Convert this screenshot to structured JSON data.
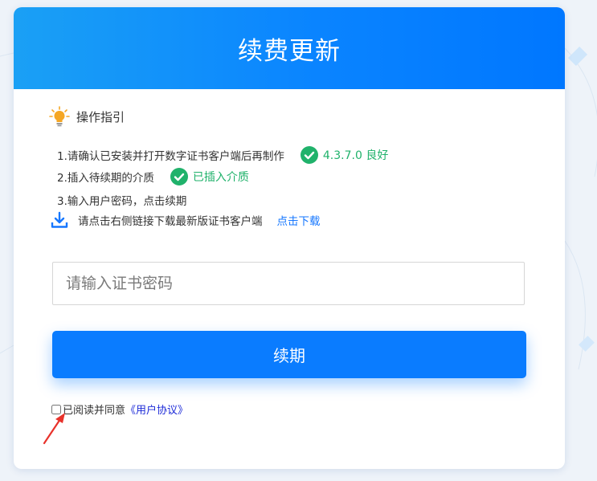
{
  "header": {
    "title": "续费更新"
  },
  "guide": {
    "title": "操作指引",
    "steps": [
      {
        "text": "1.请确认已安装并打开数字证书客户端后再制作",
        "status": "4.3.7.0 良好"
      },
      {
        "text": "2.插入待续期的介质",
        "status": "已插入介质"
      },
      {
        "text": "3.输入用户密码，点击续期"
      }
    ],
    "download": {
      "text": "请点击右侧链接下载最新版证书客户端",
      "link": "点击下载"
    }
  },
  "password": {
    "placeholder": "请输入证书密码",
    "value": ""
  },
  "renew_button": {
    "label": "续期"
  },
  "agreement": {
    "prefix": "已阅读并同意",
    "link": "《用户协议》",
    "checked": false
  },
  "colors": {
    "primary": "#0a7cff",
    "success": "#20b26b",
    "link": "#1677ff",
    "bulb": "#f5a623"
  },
  "icons": [
    "lightbulb-icon",
    "check-circle-icon",
    "download-icon",
    "arrow-pointer-icon"
  ]
}
